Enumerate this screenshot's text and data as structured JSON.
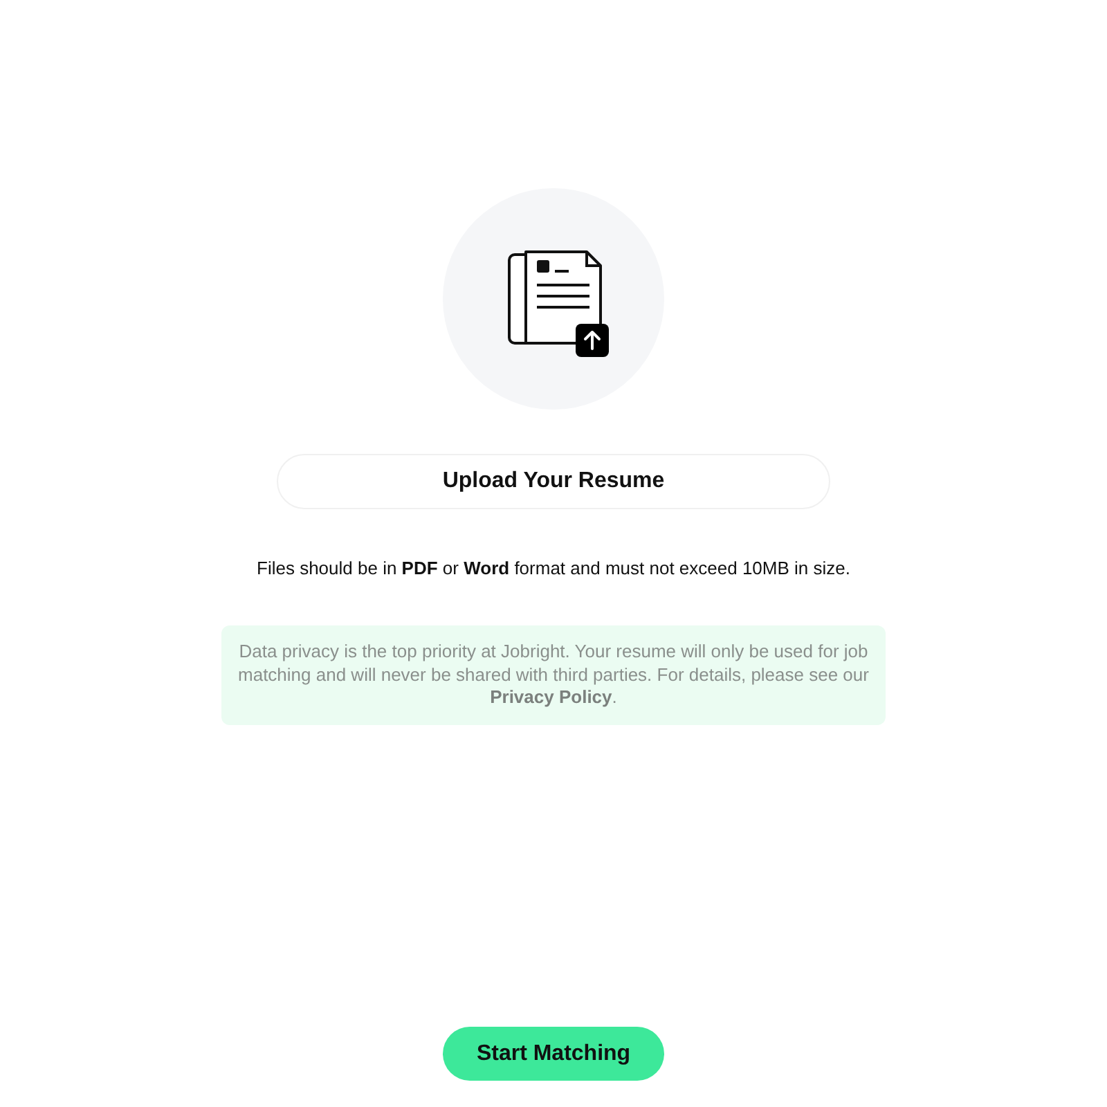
{
  "upload_button": {
    "label": "Upload Your Resume"
  },
  "hint": "Files should be in **PDF** or **Word** format and must not exceed 10MB in size.",
  "privacy_notice": {
    "text": "Data privacy is the top priority at Jobright. Your resume will only be used for job matching and will never be shared with third parties. For details, please see our",
    "link": "Privacy Policy",
    "end": "."
  },
  "start_button": {
    "label": "Start Matching"
  }
}
